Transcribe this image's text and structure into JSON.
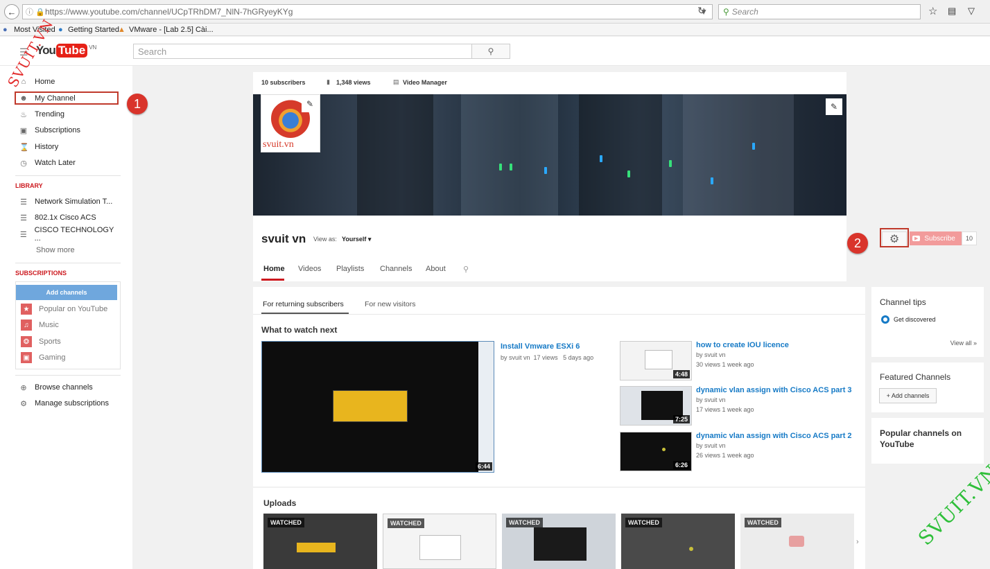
{
  "browser": {
    "url": "https://www.youtube.com/channel/UCpTRhDM7_NlN-7hGRyeyKYg",
    "search_placeholder": "Search",
    "bookmarks": [
      "Most Visited",
      "Getting Started",
      "VMware - [Lab 2.5] Cài..."
    ]
  },
  "youtube": {
    "search_placeholder": "Search",
    "locale": "VN"
  },
  "guide": {
    "items": [
      {
        "label": "Home",
        "icon": "home-icon"
      },
      {
        "label": "My Channel",
        "icon": "person-icon"
      },
      {
        "label": "Trending",
        "icon": "flame-icon"
      },
      {
        "label": "Subscriptions",
        "icon": "subscriptions-icon"
      },
      {
        "label": "History",
        "icon": "hourglass-icon"
      },
      {
        "label": "Watch Later",
        "icon": "clock-icon"
      }
    ],
    "library_heading": "LIBRARY",
    "library": [
      {
        "label": "Network Simulation T..."
      },
      {
        "label": "802.1x Cisco ACS"
      },
      {
        "label": "CISCO TECHNOLOGY ..."
      }
    ],
    "show_more": "Show more",
    "subscriptions_heading": "SUBSCRIPTIONS",
    "add_channels": "Add channels",
    "subscriptions": [
      {
        "label": "Popular on YouTube",
        "icon": "star-icon"
      },
      {
        "label": "Music",
        "icon": "music-icon"
      },
      {
        "label": "Sports",
        "icon": "sports-icon"
      },
      {
        "label": "Gaming",
        "icon": "gaming-icon"
      }
    ],
    "browse_channels": "Browse channels",
    "manage_subscriptions": "Manage subscriptions"
  },
  "channel": {
    "subscribers": "10 subscribers",
    "views": "1,348 views",
    "video_manager": "Video Manager",
    "avatar_text": "svuit.vn",
    "name": "svuit vn",
    "view_as_label": "View as:",
    "view_as_value": "Yourself",
    "subscribe_label": "Subscribe",
    "subscribe_count": "10",
    "tabs": [
      "Home",
      "Videos",
      "Playlists",
      "Channels",
      "About"
    ]
  },
  "feed": {
    "subtabs": [
      "For returning subscribers",
      "For new visitors"
    ],
    "section_title": "What to watch next",
    "featured": {
      "title": "Install Vmware ESXi 6",
      "by": "by svuit vn",
      "views": "17 views",
      "age": "5 days ago",
      "duration": "6:44"
    },
    "side_videos": [
      {
        "title": "how to create IOU licence",
        "by": "by svuit vn",
        "meta": "30 views   1 week ago",
        "duration": "4:48"
      },
      {
        "title": "dynamic vlan assign with Cisco ACS part 3",
        "by": "by svuit vn",
        "meta": "17 views   1 week ago",
        "duration": "7:25"
      },
      {
        "title": "dynamic vlan assign with Cisco ACS part 2",
        "by": "by svuit vn",
        "meta": "26 views   1 week ago",
        "duration": "6:26"
      }
    ],
    "uploads_title": "Uploads",
    "watched_label": "WATCHED"
  },
  "sidebar": {
    "tips_title": "Channel tips",
    "tip_item": "Get discovered",
    "view_all": "View all",
    "featured_title": "Featured Channels",
    "add_channels_btn": "+ Add channels",
    "popular_title": "Popular channels on YouTube"
  },
  "annotations": {
    "step1": "1",
    "step2": "2",
    "watermark": "SVUIT.VN",
    "watermark_left": "SVUIT.VN"
  }
}
